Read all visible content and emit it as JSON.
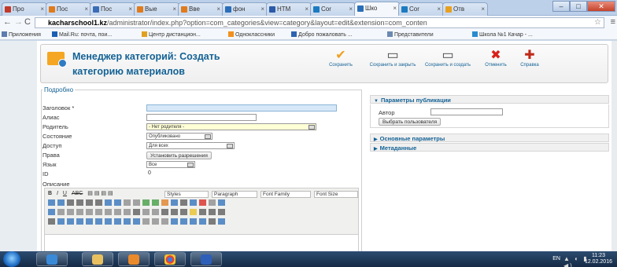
{
  "browser": {
    "tabs": [
      {
        "label": "Про",
        "favicon_color": "#c23a2b"
      },
      {
        "label": "Пос",
        "favicon_color": "#e07b1c"
      },
      {
        "label": "Пос",
        "favicon_color": "#3a6db5"
      },
      {
        "label": "Вые",
        "favicon_color": "#e07b1c"
      },
      {
        "label": "Вве",
        "favicon_color": "#e07b1c"
      },
      {
        "label": "фон",
        "favicon_color": "#2a6eb8"
      },
      {
        "label": "HTM",
        "favicon_color": "#2a5aa8"
      },
      {
        "label": "Cor",
        "favicon_color": "#1c7bc0"
      },
      {
        "label": "Шко",
        "favicon_color": "#2a6eb8",
        "active": true
      },
      {
        "label": "Cor",
        "favicon_color": "#1c7bc0"
      },
      {
        "label": "Отв",
        "favicon_color": "#e8a020"
      }
    ],
    "url_host": "kacharschool1.kz",
    "url_path": "/administrator/index.php?option=com_categories&view=category&layout=edit&extension=com_conten",
    "bookmarks": [
      {
        "label": "Приложения",
        "color": "#5b7db0"
      },
      {
        "label": "Mail.Ru: почта, пои...",
        "color": "#1a5fb4"
      },
      {
        "label": "Центр дистанцион...",
        "color": "#e0a020"
      },
      {
        "label": "Одноклассники",
        "color": "#f29020"
      },
      {
        "label": "Добро пожаловать ...",
        "color": "#2c64b0"
      },
      {
        "label": "Представители",
        "color": "#6a8ab0"
      },
      {
        "label": "Школа №1 Качар - ...",
        "color": "#2a8ad0"
      }
    ]
  },
  "header": {
    "title_line1": "Менеджер категорий: Создать",
    "title_line2": "категорию материалов",
    "toolbar": [
      {
        "label": "Сохранить",
        "icon": "check-icon",
        "color": "#f0a020"
      },
      {
        "label": "Сохранить и закрыть",
        "icon": "save-close-icon",
        "color": "#444"
      },
      {
        "label": "Сохранить и создать",
        "icon": "save-new-icon",
        "color": "#444"
      },
      {
        "label": "Отменить",
        "icon": "cancel-icon",
        "color": "#d8201a"
      },
      {
        "label": "Справка",
        "icon": "help-icon",
        "color": "#c02a1a"
      }
    ]
  },
  "form": {
    "legend": "Подробно",
    "fields": {
      "title_label": "Заголовок *",
      "alias_label": "Алиас",
      "parent_label": "Родитель",
      "parent_value": "- Нет родителя -",
      "state_label": "Состояние",
      "state_value": "Опубликовано",
      "access_label": "Доступ",
      "access_value": "Для всех",
      "rights_label": "Права",
      "rights_button": "Установить разрешения",
      "language_label": "Язык",
      "language_value": "Все",
      "id_label": "ID",
      "id_value": "0",
      "description_label": "Описание"
    },
    "editor": {
      "styles": "Styles",
      "paragraph": "Paragraph",
      "font_family": "Font Family",
      "font_size": "Font Size"
    }
  },
  "panel": {
    "publish_header": "Параметры публикации",
    "author_label": "Автор",
    "select_user_button": "Выбрать пользователя",
    "basic_header": "Основные параметры",
    "meta_header": "Метаданные"
  },
  "taskbar": {
    "lang": "EN",
    "time": "11:23",
    "date": "12.02.2016"
  }
}
